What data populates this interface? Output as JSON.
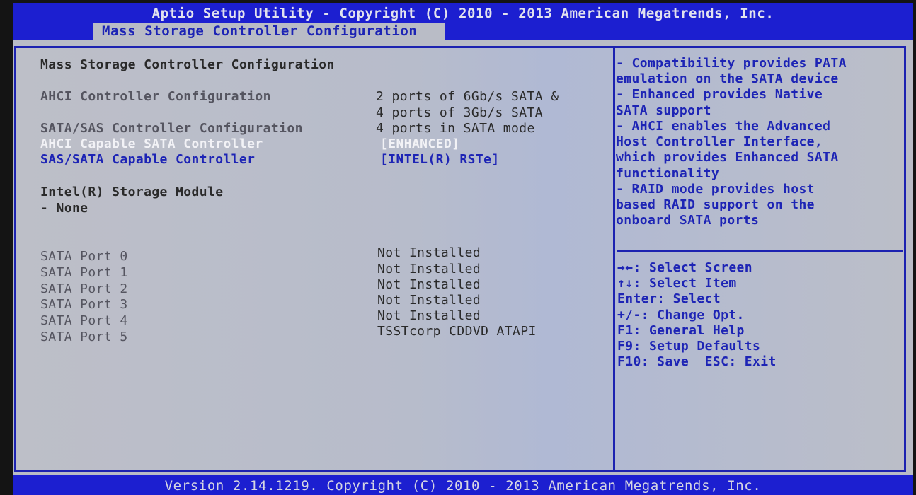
{
  "header": {
    "title": "Aptio Setup Utility - Copyright (C) 2010 - 2013 American Megatrends, Inc.",
    "active_tab": "Mass Storage Controller Configuration"
  },
  "main": {
    "section_title": "Mass Storage Controller Configuration",
    "ahci_config": {
      "label": "AHCI Controller Configuration",
      "value_line1": "2 ports of 6Gb/s SATA &",
      "value_line2": "4 ports of 3Gb/s SATA"
    },
    "sata_sas_config": {
      "label": "SATA/SAS Controller Configuration",
      "value": "4 ports in SATA mode"
    },
    "ahci_capable": {
      "label": "AHCI Capable SATA Controller",
      "value": "[ENHANCED]"
    },
    "sas_sata_capable": {
      "label": "SAS/SATA Capable Controller",
      "value": "[INTEL(R) RSTe]"
    },
    "storage_module": {
      "label": "Intel(R) Storage Module",
      "value": "- None"
    },
    "ports": [
      {
        "label": "SATA Port 0",
        "value": "Not Installed"
      },
      {
        "label": "SATA Port 1",
        "value": "Not Installed"
      },
      {
        "label": "SATA Port 2",
        "value": "Not Installed"
      },
      {
        "label": "SATA Port 3",
        "value": "Not Installed"
      },
      {
        "label": "SATA Port 4",
        "value": "Not Installed"
      },
      {
        "label": "SATA Port 5",
        "value": "TSSTcorp CDDVD ATAPI"
      }
    ]
  },
  "help": {
    "lines": [
      "- Compatibility provides PATA",
      "emulation on the SATA device",
      "- Enhanced provides Native",
      "SATA support",
      "- AHCI enables the Advanced",
      "Host Controller Interface,",
      "which provides Enhanced SATA",
      "functionality",
      "- RAID mode provides host",
      "based RAID support on the",
      "onboard SATA ports"
    ]
  },
  "keys": [
    "→←: Select Screen",
    "↑↓: Select Item",
    "Enter: Select",
    "+/-: Change Opt.",
    "F1: General Help",
    "F9: Setup Defaults",
    "F10: Save  ESC: Exit"
  ],
  "footer": {
    "text": "Version 2.14.1219. Copyright (C) 2010 - 2013 American Megatrends, Inc."
  }
}
